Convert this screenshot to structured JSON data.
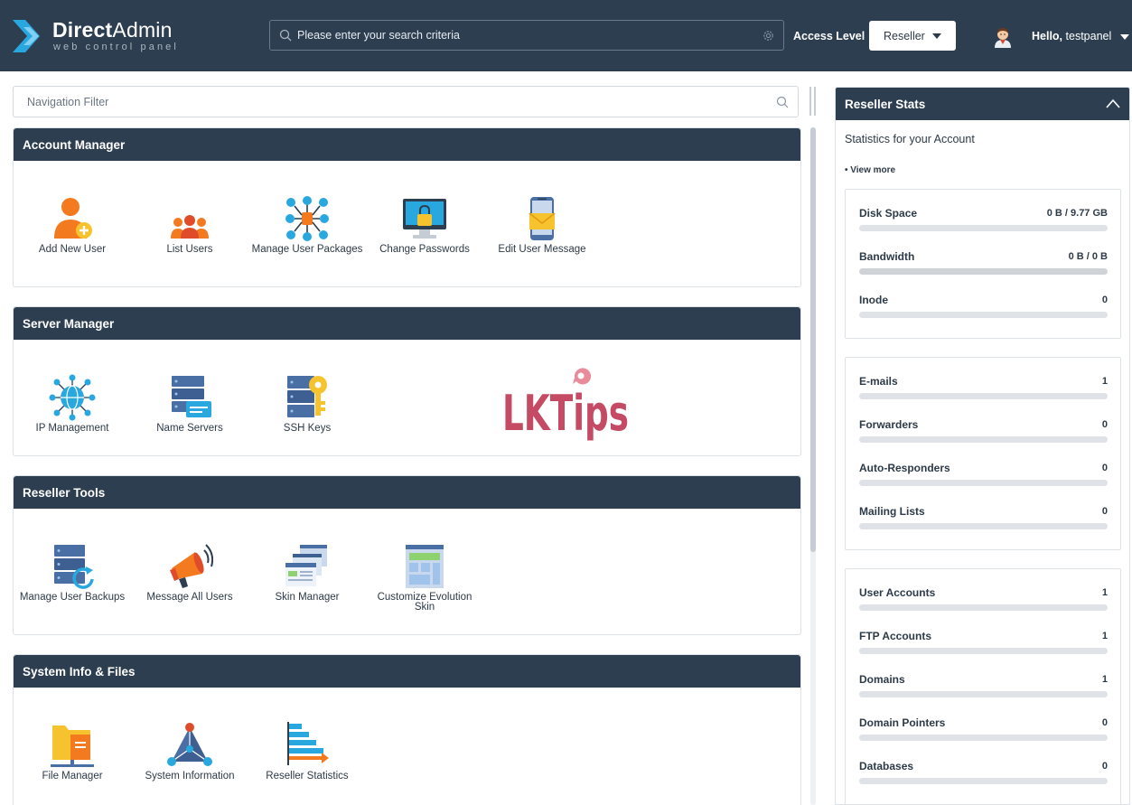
{
  "header": {
    "logo_title_bold": "Direct",
    "logo_title_thin": "Admin",
    "logo_subtitle": "web control panel",
    "search_placeholder": "Please enter your search criteria",
    "access_level_label": "Access Level",
    "access_level_value": "Reseller",
    "greeting_prefix": "Hello,",
    "username": "testpanel"
  },
  "nav_filter": {
    "placeholder": "Navigation Filter"
  },
  "sections": {
    "account_manager": {
      "title": "Account Manager",
      "items": [
        {
          "label": "Add New User",
          "icon": "add-user-icon"
        },
        {
          "label": "List Users",
          "icon": "users-group-icon"
        },
        {
          "label": "Manage User Packages",
          "icon": "packages-icon"
        },
        {
          "label": "Change Passwords",
          "icon": "monitor-lock-icon"
        },
        {
          "label": "Edit User Message",
          "icon": "phone-message-icon"
        }
      ]
    },
    "server_manager": {
      "title": "Server Manager",
      "items": [
        {
          "label": "IP Management",
          "icon": "globe-network-icon"
        },
        {
          "label": "Name Servers",
          "icon": "server-icon"
        },
        {
          "label": "SSH Keys",
          "icon": "server-key-icon"
        }
      ]
    },
    "reseller_tools": {
      "title": "Reseller Tools",
      "items": [
        {
          "label": "Manage User Backups",
          "icon": "server-backup-icon"
        },
        {
          "label": "Message All Users",
          "icon": "megaphone-icon"
        },
        {
          "label": "Skin Manager",
          "icon": "skin-windows-icon"
        },
        {
          "label": "Customize Evolution Skin",
          "icon": "layout-icon"
        }
      ]
    },
    "system_info": {
      "title": "System Info & Files",
      "items": [
        {
          "label": "File Manager",
          "icon": "folder-icon"
        },
        {
          "label": "System Information",
          "icon": "network-triangle-icon"
        },
        {
          "label": "Reseller Statistics",
          "icon": "stats-bars-icon"
        }
      ]
    }
  },
  "watermark": {
    "text": "LKTips"
  },
  "stats": {
    "title": "Reseller Stats",
    "subtitle": "Statistics for your Account",
    "view_more": "• View more",
    "groups": [
      [
        {
          "label": "Disk Space",
          "value": "0 B / 9.77 GB",
          "fraction": 0
        },
        {
          "label": "Bandwidth",
          "value": "0 B / 0 B",
          "fraction": 0,
          "full_track": true
        },
        {
          "label": "Inode",
          "value": "0",
          "fraction": 0
        }
      ],
      [
        {
          "label": "E-mails",
          "value": "1",
          "fraction": 0
        },
        {
          "label": "Forwarders",
          "value": "0",
          "fraction": 0
        },
        {
          "label": "Auto-Responders",
          "value": "0",
          "fraction": 0
        },
        {
          "label": "Mailing Lists",
          "value": "0",
          "fraction": 0
        }
      ],
      [
        {
          "label": "User Accounts",
          "value": "1",
          "fraction": 0
        },
        {
          "label": "FTP Accounts",
          "value": "1",
          "fraction": 0
        },
        {
          "label": "Domains",
          "value": "1",
          "fraction": 0
        },
        {
          "label": "Domain Pointers",
          "value": "0",
          "fraction": 0
        },
        {
          "label": "Databases",
          "value": "0",
          "fraction": 0
        }
      ]
    ]
  },
  "colors": {
    "header_bg": "#2d3e50",
    "accent_blue": "#29a8e0",
    "orange": "#f47a20",
    "yellow": "#f6c22e"
  }
}
